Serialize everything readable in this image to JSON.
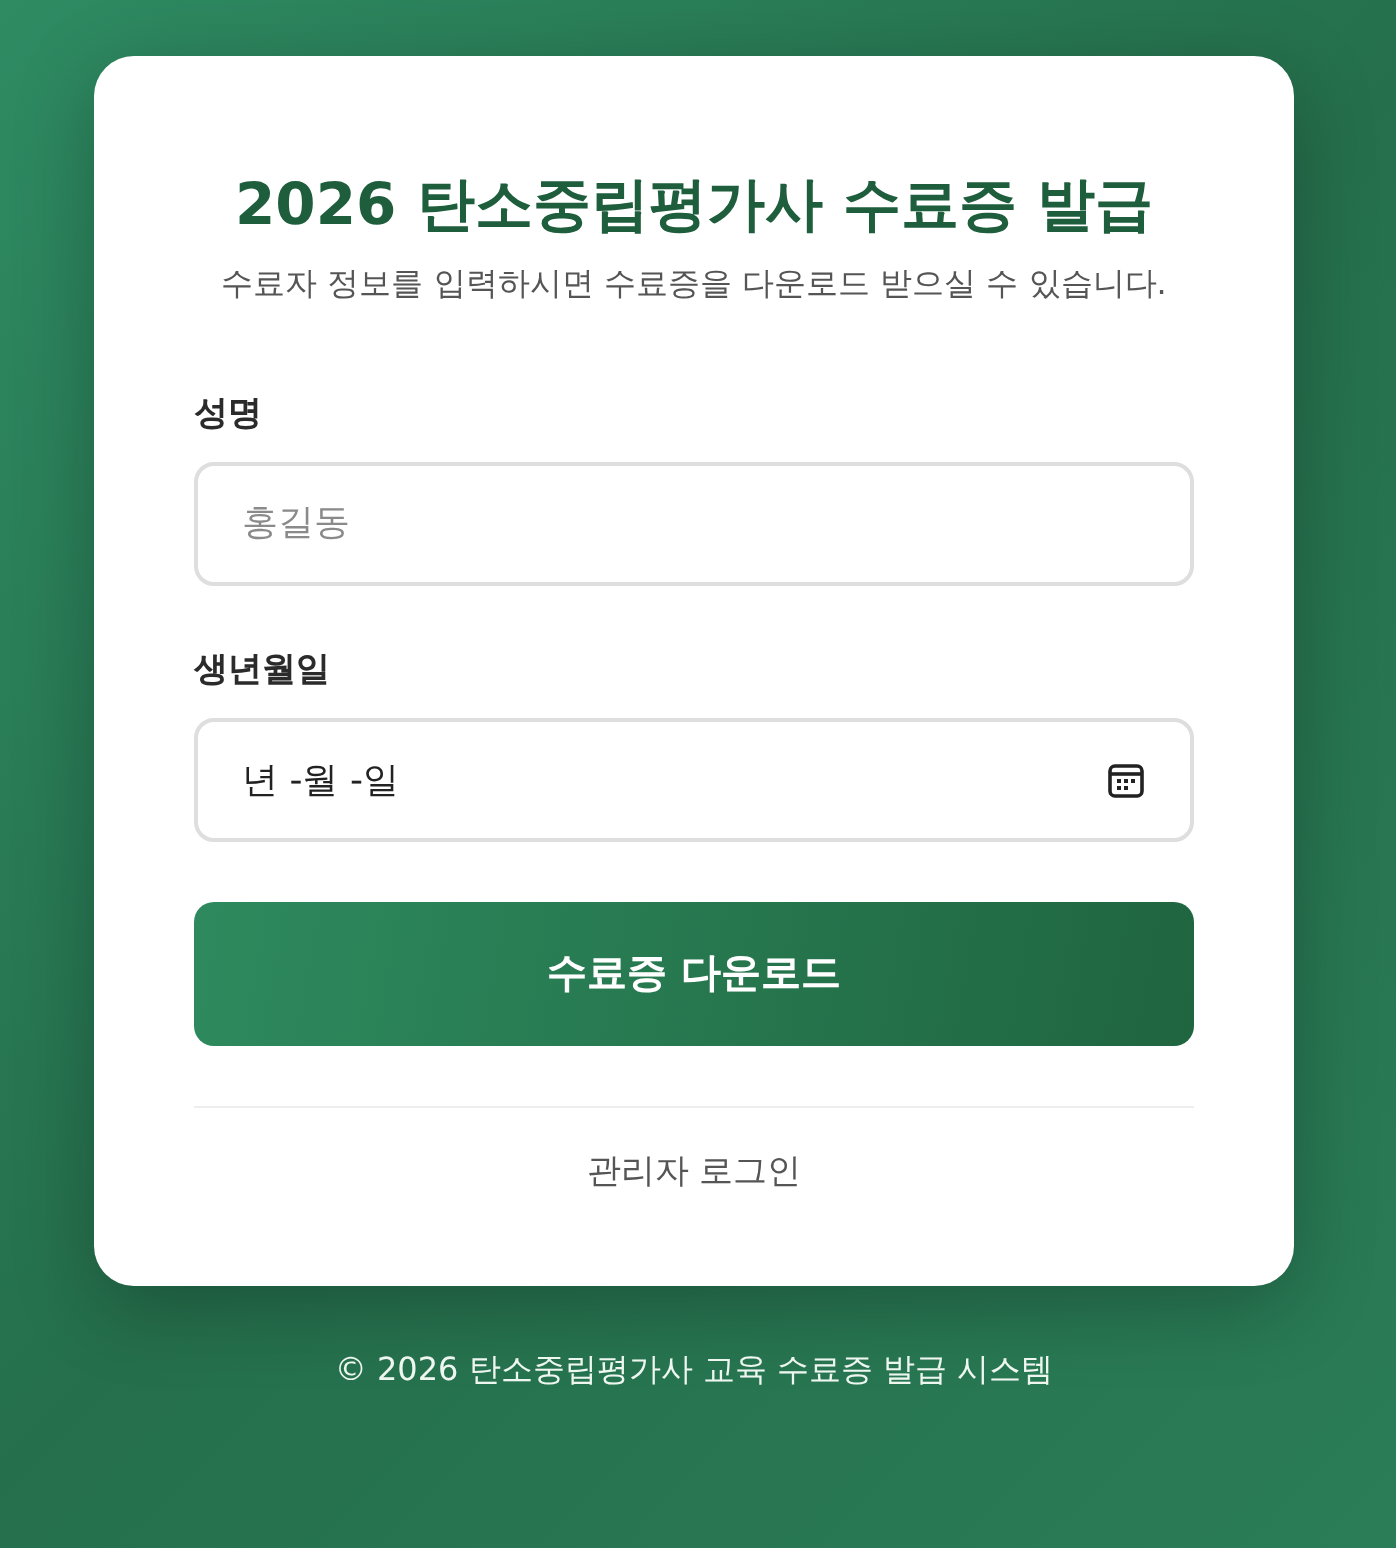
{
  "title": "2026 탄소중립평가사 수료증 발급",
  "subtitle": "수료자 정보를 입력하시면 수료증을 다운로드 받으실 수 있습니다.",
  "fields": [
    {
      "kind": "text",
      "label": "성명",
      "placeholder": "홍길동"
    },
    {
      "kind": "date",
      "label": "생년월일",
      "placeholder": "년 -월 -일"
    }
  ],
  "submit_button": "수료증 다운로드",
  "admin_link": "관리자 로그인",
  "footer": "© 2026 탄소중립평가사 교육 수료증 발급 시스템"
}
